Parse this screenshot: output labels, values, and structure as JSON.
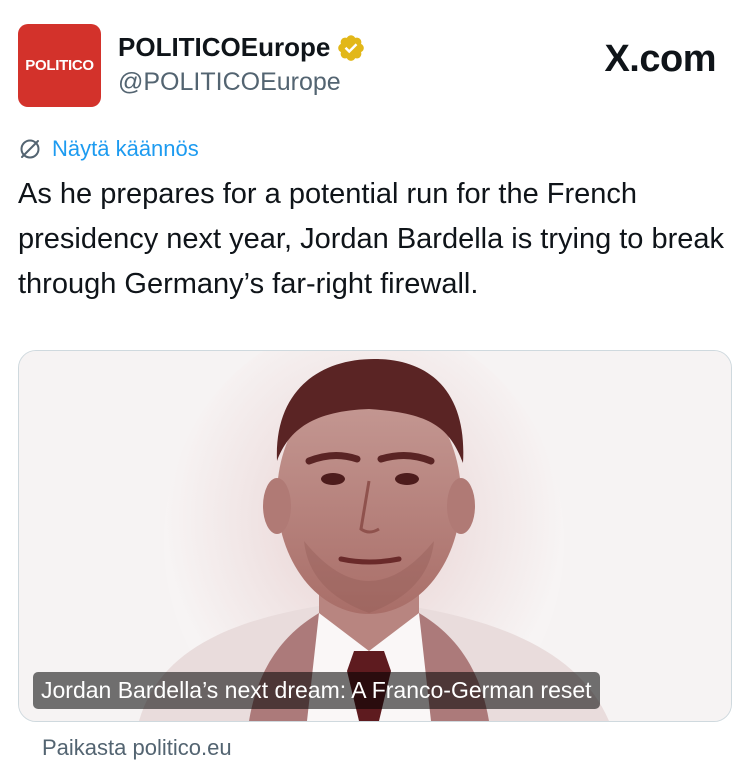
{
  "account": {
    "avatar_text": "POLITICO",
    "display_name": "POLITICOEurope",
    "handle": "@POLITICOEurope",
    "verified_icon": "verified-badge-gold"
  },
  "branding": {
    "site": "X.com"
  },
  "translate": {
    "label": "Näytä käännös",
    "icon": "translate-icon"
  },
  "tweet": {
    "text": "As he prepares for a potential run for the French presidency next year, Jordan Bardella is trying to break through Germany’s far-right firewall."
  },
  "link_card": {
    "title": "Jordan Bardella’s next dream: A Franco-German reset"
  },
  "source": {
    "label": "Paikasta politico.eu"
  },
  "colors": {
    "avatar_bg": "#d3322b",
    "link_blue": "#1d9bf0",
    "secondary_text": "#536471",
    "verified_gold": "#e2b719"
  }
}
